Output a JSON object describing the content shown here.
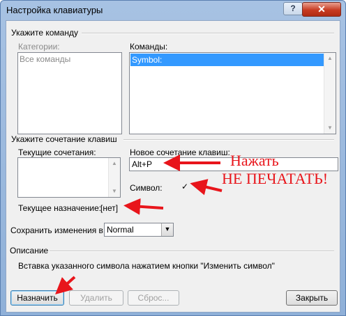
{
  "window": {
    "title": "Настройка клавиатуры",
    "help_label": "?",
    "close_label": "✕"
  },
  "command_group": {
    "heading": "Укажите команду",
    "categories_label": "Категории:",
    "categories_items": [
      "Все команды"
    ],
    "commands_label": "Команды:",
    "commands_items": [
      "Symbol:"
    ],
    "commands_selected": "Symbol:"
  },
  "shortcut_group": {
    "heading": "Укажите сочетание клавиш",
    "current_keys_label": "Текущие сочетания:",
    "new_key_label": "Новое сочетание клавиш:",
    "new_key_value": "Alt+P",
    "symbol_label": "Символ:",
    "symbol_value": "✓",
    "current_assignment_label": "Текущее назначение:",
    "current_assignment_value": "[нет]"
  },
  "save_changes": {
    "label": "Сохранить изменения в:",
    "value": "Normal"
  },
  "description": {
    "heading": "Описание",
    "text": "Вставка указанного символа нажатием кнопки \"Изменить символ\""
  },
  "buttons": {
    "assign": "Назначить",
    "remove": "Удалить",
    "reset": "Сброс...",
    "close": "Закрыть"
  },
  "annotations": {
    "press": "Нажать",
    "do_not_type": "НЕ ПЕЧАТАТЬ!",
    "color": "#e8151b"
  }
}
